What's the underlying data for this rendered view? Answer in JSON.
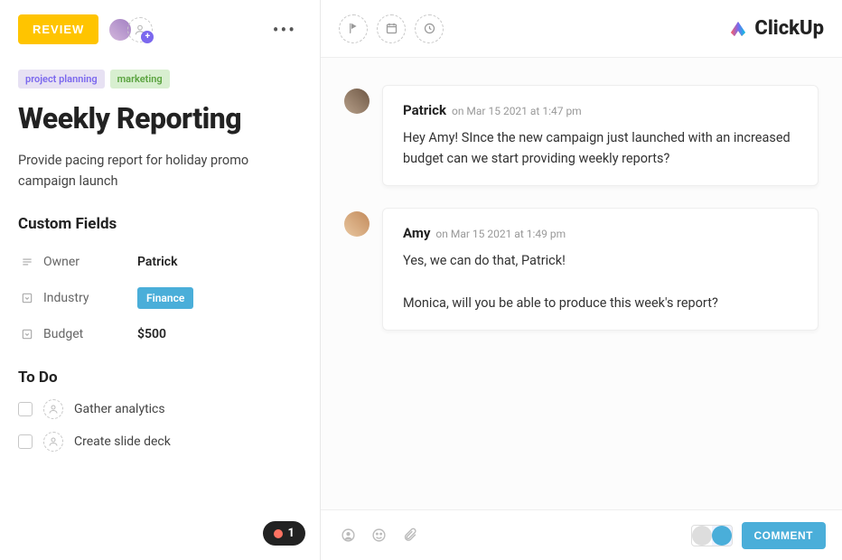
{
  "header": {
    "status_label": "REVIEW",
    "logo_text": "ClickUp"
  },
  "tags": [
    "project planning",
    "marketing"
  ],
  "task": {
    "title": "Weekly Reporting",
    "description": "Provide pacing report for holiday promo campaign launch"
  },
  "custom_fields": {
    "heading": "Custom Fields",
    "rows": [
      {
        "icon": "lines-icon",
        "label": "Owner",
        "value": "Patrick",
        "type": "text"
      },
      {
        "icon": "dropdown-icon",
        "label": "Industry",
        "value": "Finance",
        "type": "chip"
      },
      {
        "icon": "dropdown-icon",
        "label": "Budget",
        "value": "$500",
        "type": "text"
      }
    ]
  },
  "todo": {
    "heading": "To Do",
    "items": [
      {
        "label": "Gather analytics",
        "checked": false
      },
      {
        "label": "Create slide deck",
        "checked": false
      }
    ]
  },
  "figma_badge": {
    "count": "1"
  },
  "comments": [
    {
      "author": "Patrick",
      "timestamp": "on Mar 15 2021 at 1:47 pm",
      "text": "Hey Amy! SInce the new campaign just launched with an increased budget can we start providing weekly reports?",
      "avatar_class": "patrick"
    },
    {
      "author": "Amy",
      "timestamp": "on Mar 15 2021 at 1:49 pm",
      "text": "Yes, we can do that, Patrick!\n\nMonica, will you be able to produce this week's report?",
      "avatar_class": "amy"
    }
  ],
  "footer": {
    "comment_button": "COMMENT"
  }
}
